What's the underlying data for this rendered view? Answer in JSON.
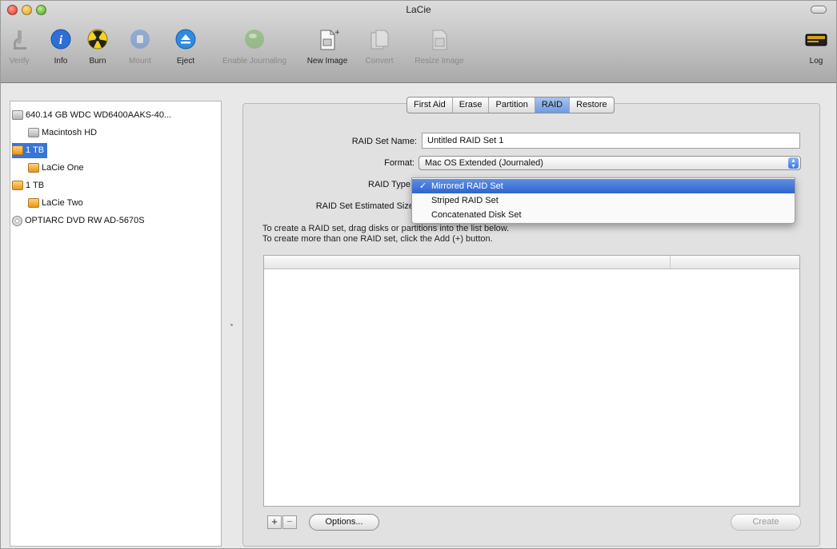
{
  "window": {
    "title": "LaCie"
  },
  "toolbar": {
    "items": [
      {
        "label": "Verify",
        "icon": "microscope-icon",
        "enabled": false
      },
      {
        "label": "Info",
        "icon": "info-icon",
        "enabled": true
      },
      {
        "label": "Burn",
        "icon": "burn-icon",
        "enabled": true
      },
      {
        "label": "Mount",
        "icon": "mount-icon",
        "enabled": false
      },
      {
        "label": "Eject",
        "icon": "eject-icon",
        "enabled": true
      },
      {
        "label": "Enable Journaling",
        "icon": "journaling-icon",
        "enabled": false
      },
      {
        "label": "New Image",
        "icon": "new-image-icon",
        "enabled": true
      },
      {
        "label": "Convert",
        "icon": "convert-icon",
        "enabled": false
      },
      {
        "label": "Resize Image",
        "icon": "resize-image-icon",
        "enabled": false
      },
      {
        "label": "Log",
        "icon": "log-icon",
        "enabled": true
      }
    ]
  },
  "sidebar": {
    "items": [
      {
        "label": "640.14 GB WDC WD6400AAKS-40...",
        "icon": "hard-disk-icon",
        "selected": false
      },
      {
        "label": "Macintosh HD",
        "icon": "volume-icon",
        "selected": false
      },
      {
        "label": "1 TB",
        "icon": "external-disk-icon",
        "selected": true
      },
      {
        "label": "LaCie One",
        "icon": "external-volume-icon",
        "selected": false
      },
      {
        "label": "1 TB",
        "icon": "external-disk-icon",
        "selected": false
      },
      {
        "label": "LaCie Two",
        "icon": "external-volume-icon",
        "selected": false
      },
      {
        "label": "OPTIARC DVD RW AD-5670S",
        "icon": "optical-drive-icon",
        "selected": false
      }
    ]
  },
  "tabs": {
    "items": [
      "First Aid",
      "Erase",
      "Partition",
      "RAID",
      "Restore"
    ],
    "active": "RAID"
  },
  "raid": {
    "set_name_label": "RAID Set Name:",
    "set_name_value": "Untitled RAID Set 1",
    "format_label": "Format:",
    "format_value": "Mac OS Extended (Journaled)",
    "type_label": "RAID Type",
    "size_label": "RAID Set Estimated Size",
    "instructions_line1": "To create a RAID set, drag disks or partitions into the list below.",
    "instructions_line2": "To create more than one RAID set, click the Add (+) button."
  },
  "raid_type_menu": {
    "options": [
      "Mirrored RAID Set",
      "Striped RAID Set",
      "Concatenated Disk Set"
    ],
    "selected": "Mirrored RAID Set",
    "check_mark": "✓"
  },
  "bottom": {
    "add_label": "+",
    "remove_label": "−",
    "options_label": "Options...",
    "create_label": "Create"
  },
  "colors": {
    "selection": "#3875d7",
    "menu_highlight": "#2f64cf"
  }
}
